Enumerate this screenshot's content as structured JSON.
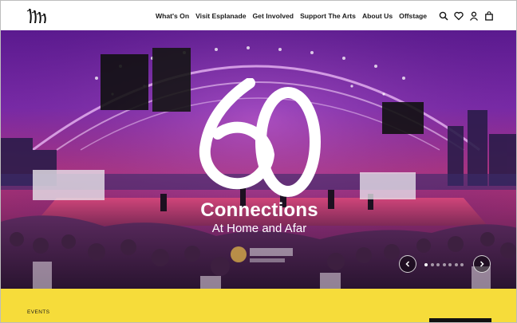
{
  "nav": {
    "items": [
      "What's On",
      "Visit Esplanade",
      "Get Involved",
      "Support The Arts",
      "About Us",
      "Offstage"
    ],
    "icons": [
      "search-icon",
      "heart-icon",
      "user-icon",
      "bag-icon"
    ]
  },
  "hero": {
    "numeral": "60",
    "title": "Connections",
    "subtitle": "At Home and Afar",
    "slide_count": 7,
    "active_slide": 1
  },
  "events": {
    "label": "EVENTS"
  },
  "colors": {
    "accent_yellow": "#f6dc3a",
    "hero_purple": "#6a2399",
    "hero_magenta": "#b2357c"
  }
}
